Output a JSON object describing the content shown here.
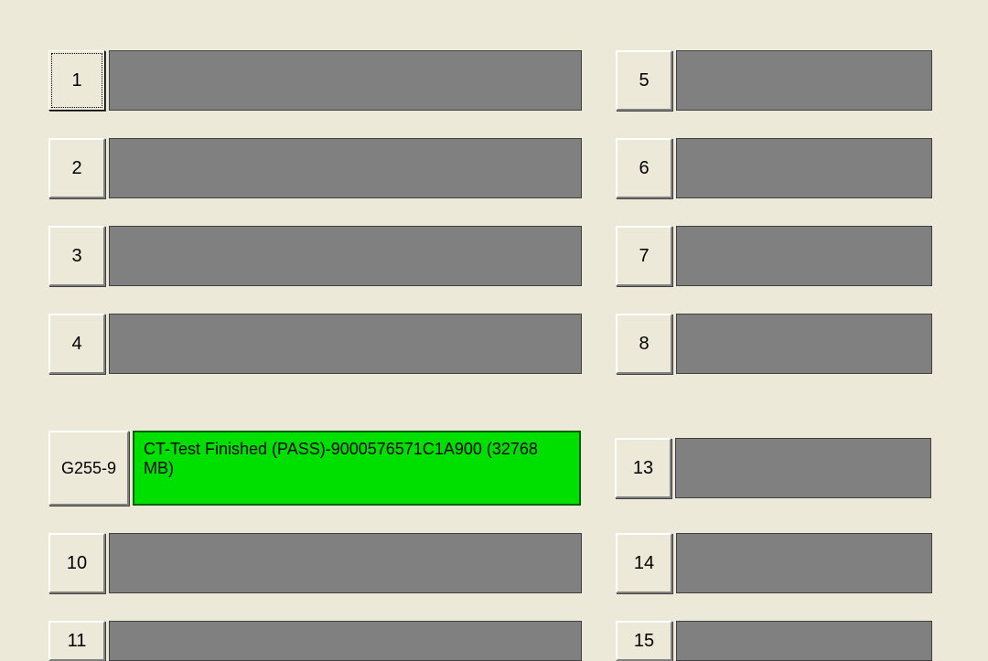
{
  "rows_block1": [
    {
      "leftBtn": "1",
      "leftStatus": "",
      "leftSelected": true,
      "rightBtn": "5",
      "rightStatus": ""
    },
    {
      "leftBtn": "2",
      "leftStatus": "",
      "leftSelected": false,
      "rightBtn": "6",
      "rightStatus": ""
    },
    {
      "leftBtn": "3",
      "leftStatus": "",
      "leftSelected": false,
      "rightBtn": "7",
      "rightStatus": ""
    },
    {
      "leftBtn": "4",
      "leftStatus": "",
      "leftSelected": false,
      "rightBtn": "8",
      "rightStatus": ""
    }
  ],
  "rows_block2": [
    {
      "leftBtn": "G255-9",
      "leftStatus": "CT-Test Finished (PASS)-9000576571C1A900 (32768 MB)",
      "leftPass": true,
      "leftWide": true,
      "rightBtn": "13",
      "rightStatus": ""
    },
    {
      "leftBtn": "10",
      "leftStatus": "",
      "leftPass": false,
      "leftWide": false,
      "rightBtn": "14",
      "rightStatus": ""
    },
    {
      "leftBtn": "11",
      "leftStatus": "",
      "leftPass": false,
      "leftWide": false,
      "rightBtn": "15",
      "rightStatus": ""
    }
  ]
}
